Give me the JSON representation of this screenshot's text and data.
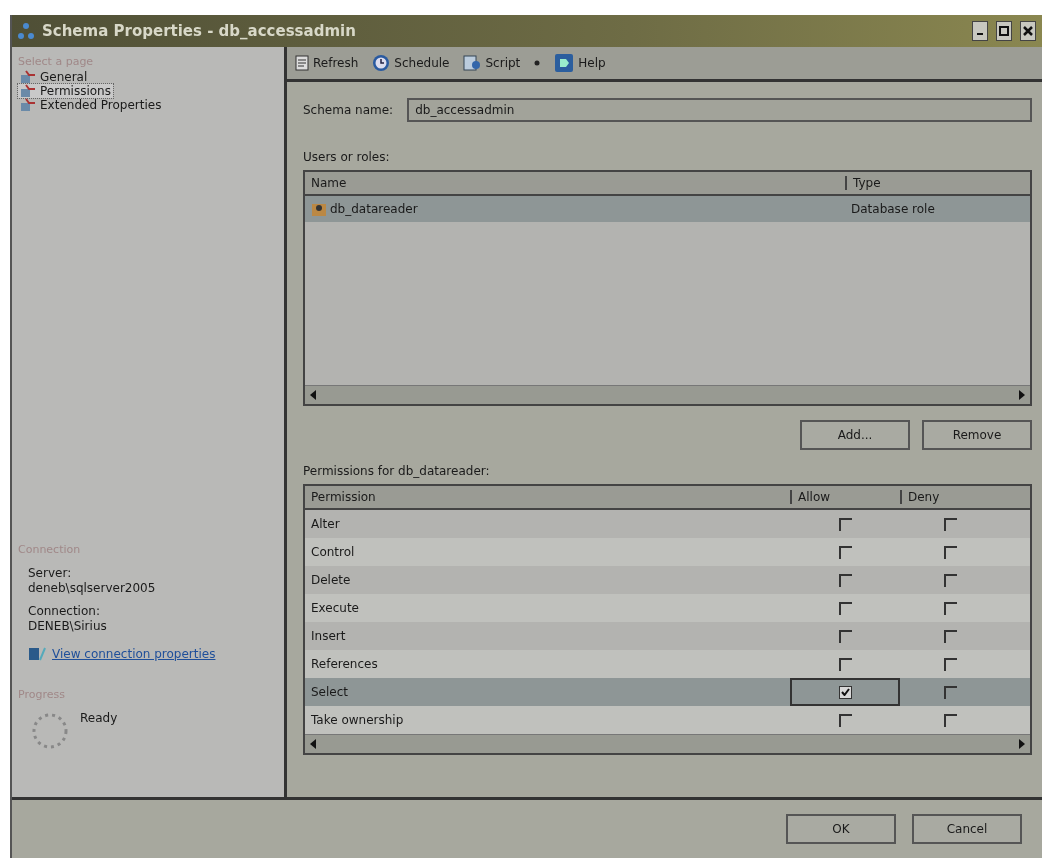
{
  "window": {
    "title": "Schema Properties - db_accessadmin"
  },
  "sidebar": {
    "header": "Select a page",
    "items": [
      {
        "label": "General",
        "selected": false
      },
      {
        "label": "Permissions",
        "selected": true
      },
      {
        "label": "Extended Properties",
        "selected": false
      }
    ],
    "connection": {
      "header": "Connection",
      "server_label": "Server:",
      "server": "deneb\\sqlserver2005",
      "connection_label": "Connection:",
      "connection": "DENEB\\Sirius",
      "link": "View connection properties"
    },
    "progress": {
      "header": "Progress",
      "status": "Ready"
    }
  },
  "toolbar": [
    {
      "kind": "refresh",
      "label": "Refresh"
    },
    {
      "kind": "schedule",
      "label": "Schedule"
    },
    {
      "kind": "script",
      "label": "Script"
    },
    {
      "kind": "dropdown"
    },
    {
      "kind": "help",
      "label": "Help"
    }
  ],
  "schema_name": {
    "label": "Schema name:",
    "value": "db_accessadmin"
  },
  "users": {
    "label": "Users or roles:",
    "columns": [
      "Name",
      "Type"
    ],
    "rows": [
      {
        "name": "db_datareader",
        "type": "Database role",
        "selected": true
      }
    ]
  },
  "user_buttons": [
    "Add...",
    "Remove"
  ],
  "permissions": {
    "label": "Permissions for db_datareader:",
    "columns": [
      "Permission",
      "Allow",
      "Deny"
    ],
    "rows": [
      {
        "name": "Alter",
        "allow": false,
        "deny": false,
        "selected": false
      },
      {
        "name": "Control",
        "allow": false,
        "deny": false,
        "selected": false
      },
      {
        "name": "Delete",
        "allow": false,
        "deny": false,
        "selected": false
      },
      {
        "name": "Execute",
        "allow": false,
        "deny": false,
        "selected": false
      },
      {
        "name": "Insert",
        "allow": false,
        "deny": false,
        "selected": false
      },
      {
        "name": "References",
        "allow": false,
        "deny": false,
        "selected": false
      },
      {
        "name": "Select",
        "allow": true,
        "deny": false,
        "selected": true
      },
      {
        "name": "Take ownership",
        "allow": false,
        "deny": false,
        "selected": false
      }
    ]
  },
  "buttons": [
    "OK",
    "Cancel"
  ]
}
